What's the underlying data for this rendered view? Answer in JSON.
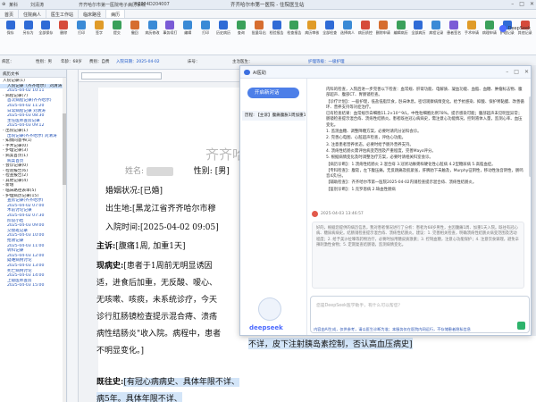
{
  "titlebar": {
    "left_items": [
      "齐齐哈尔市第一医院",
      "科室：",
      "登录人：刘清涛",
      "门诊号：",
      "住院号：",
      "发布 4.0",
      "HIS编码：",
      "住院号:"
    ],
    "left_texts": [
      "某科",
      "刘清涛",
      "齐齐哈尔市第一医院电子病历系统",
      "#2024D204007"
    ],
    "center_title": "齐齐哈尔市第一医院 - 住院医生站"
  },
  "tabs": [
    "首页",
    "住院病人",
    "医生工作站",
    "临床路径",
    "病历"
  ],
  "toolbar": {
    "buttons": [
      "保存",
      "另存为",
      "全部保存",
      "删除",
      "打印",
      "签字",
      "提交",
      "撤回",
      "病历修改",
      "事务续打",
      "编辑",
      "打印",
      "历史病历",
      "查询",
      "批量导出",
      "检验报告",
      "检查报告",
      "病历审核",
      "全部检查",
      "选择病人",
      "病历质控",
      "删除申请",
      "编辑病历",
      "全部病历",
      "病程记录",
      "患者签名",
      "手术申请",
      "病理申请",
      "护理记录",
      "其他记录"
    ],
    "colors": [
      "#2f6bd6",
      "#2f6bd6",
      "#2f6bd6",
      "#d64b3b",
      "#3a8ad6",
      "#e09b28",
      "#3aa05a",
      "#d66d2f",
      "#3a8ad6",
      "#7a5bd6",
      "#3a8ad6",
      "#3a8ad6",
      "#2f6bd6",
      "#3aa05a",
      "#d66d2f",
      "#2f6bd6",
      "#3aa05a",
      "#e09b28",
      "#2f6bd6",
      "#3a8ad6",
      "#d64b3b",
      "#d66d2f",
      "#3aa05a",
      "#2f6bd6",
      "#3a8ad6",
      "#7a5bd6",
      "#e09b28",
      "#3aa05a",
      "#2f6bd6",
      "#d64b3b"
    ],
    "right_label": "DeepSeek"
  },
  "infobar": {
    "items": [
      "病区：",
      "性别：男",
      "年龄：68岁",
      "费别：自费",
      "入院日期：2025-04-02",
      "床号：",
      "主治医生：",
      "护理等级：一级护理"
    ],
    "address_label": "出生地：黑龙江省齐齐哈尔市 ..."
  },
  "left_panel": {
    "header": "病历文书",
    "tree": [
      {
        "label": "入院记录(1)",
        "level": 0,
        "style": "normal"
      },
      {
        "label": "入院记录（齐齐哈尔）  刘清涛",
        "level": 1,
        "style": "sel"
      },
      {
        "label": "2025-04-02 10:11",
        "level": 1,
        "style": "blue"
      },
      {
        "label": "- 病程记录(7)",
        "level": 0,
        "style": "normal"
      },
      {
        "label": "首次病程记录(齐齐哈尔)",
        "level": 1,
        "style": "blue"
      },
      {
        "label": "2025-04-02 11:20",
        "level": 1,
        "style": "blue"
      },
      {
        "label": "日常病程记录 刘清涛",
        "level": 1,
        "style": "blue"
      },
      {
        "label": "2025-04-03 08:30",
        "level": 1,
        "style": "blue"
      },
      {
        "label": "主任医师查房记录",
        "level": 1,
        "style": "blue"
      },
      {
        "label": "2025-04-03 09:12",
        "level": 1,
        "style": "blue"
      },
      {
        "label": "- 出院记录(1)",
        "level": 0,
        "style": "normal"
      },
      {
        "label": "出院记录(齐齐哈尔) 刘清涛",
        "level": 1,
        "style": "blue"
      },
      {
        "label": "- 知情同意书(1)",
        "level": 0,
        "style": "normal"
      },
      {
        "label": "- 手术记录(0)",
        "level": 0,
        "style": "normal"
      },
      {
        "label": "- 护理记录(3)",
        "level": 0,
        "style": "normal"
      },
      {
        "label": "- 病案首页(1)",
        "level": 0,
        "style": "normal"
      },
      {
        "label": "病案首页",
        "level": 1,
        "style": "blue"
      },
      {
        "label": "- 会诊记录(0)",
        "level": 0,
        "style": "normal"
      },
      {
        "label": "- 检验报告(6)",
        "level": 0,
        "style": "normal"
      },
      {
        "label": "- 检查报告(2)",
        "level": 0,
        "style": "normal"
      },
      {
        "label": "- 其他记录(4)",
        "level": 0,
        "style": "normal"
      },
      {
        "label": "- 新增",
        "level": 0,
        "style": "normal"
      },
      {
        "label": "- 临床路径表单(5)",
        "level": 0,
        "style": "normal"
      },
      {
        "label": "- 护理病历记录(15)",
        "level": 0,
        "style": "normal"
      },
      {
        "label": "查房记录(齐齐哈尔)",
        "level": 1,
        "style": "blue"
      },
      {
        "label": "2025-04-02 07:00",
        "level": 1,
        "style": "blue"
      },
      {
        "label": "术前讨论记录",
        "level": 1,
        "style": "blue"
      },
      {
        "label": "2025-04-02 07:30",
        "level": 1,
        "style": "blue"
      },
      {
        "label": "阶段小结",
        "level": 1,
        "style": "blue"
      },
      {
        "label": "2025-04-03 09:00",
        "level": 1,
        "style": "blue"
      },
      {
        "label": "交接班记录",
        "level": 1,
        "style": "blue"
      },
      {
        "label": "2025-04-03 10:00",
        "level": 1,
        "style": "blue"
      },
      {
        "label": "抢救记录",
        "level": 1,
        "style": "blue"
      },
      {
        "label": "2025-04-03 11:00",
        "level": 1,
        "style": "blue"
      },
      {
        "label": "转科记录",
        "level": 1,
        "style": "blue"
      },
      {
        "label": "2025-04-03 12:00",
        "level": 1,
        "style": "blue"
      },
      {
        "label": "疑难病例讨论",
        "level": 1,
        "style": "blue"
      },
      {
        "label": "2025-04-03 13:00",
        "level": 1,
        "style": "blue"
      },
      {
        "label": "死亡病例讨论",
        "level": 1,
        "style": "blue"
      },
      {
        "label": "2025-04-03 14:00",
        "level": 1,
        "style": "blue"
      },
      {
        "label": "上级医师查房",
        "level": 1,
        "style": "blue"
      },
      {
        "label": "2025-04-03 15:00",
        "level": 1,
        "style": "blue"
      }
    ]
  },
  "editor": {
    "toolbar_input": "",
    "watermark": "齐齐哈",
    "name_label": "姓名:",
    "gender_label": "性别:",
    "gender_value": "[男]",
    "marital_label": "婚姻状况:",
    "marital_value": "[已婚]",
    "birthplace_label": "出生地:",
    "birthplace_value": "[黑龙江省齐齐哈尔市穆",
    "admit_label": "入院时间:",
    "admit_value": "[2025-04-02 09:05]",
    "chief_label": "主诉:",
    "chief_value": "[腹痛1周, 加重1天]",
    "hpi_label": "现病史:",
    "hpi_lines": [
      "[患者于1周前无明显诱因",
      "适，进食后加重，无反酸、嗳心、",
      "无咳嗽、咳痰，未系统诊疗，今天",
      "诊行肛肠镜检查提示混合痔、溃疡",
      "病性结肠炎\"收入院。病程中，患者",
      "不明显变化。]"
    ],
    "past_label": "既往史:",
    "past_lines": [
      "[有冠心病病史、具体年限不详、",
      "病5年。具体年限不详、",
      "不详，皮下注射胰岛素控制，否认高血压病史]"
    ]
  },
  "dialog": {
    "title": "AI医助",
    "new_chat": "开启新对话",
    "history_item": "历程: 【主诉】腹痛腹胀1周加重1天",
    "response_paragraphs": [
      "内科的检查，入院后进一步完善以下检查：血常规、肝肾功能、电解质、凝血功能、血脂、血糖、肿瘤标志物、腹部超声、腹部CT、胃肠镜检查。",
      "【诊疗计划】：一般护理，低盐低脂饮食，卧床休息，密切观察病情变化。给予抗感染、抑酸、保护胃黏膜、改善循环、营养支持等对症治疗。",
      "已有检查结果：血常规示白细胞11.2×10^9/L，中性粒细胞比例78%，提示感染可能；腹部超声未见明显异常；肠镜检查提示混合痔、溃疡性结肠炎。患者既往冠心病病史，需注意心功能情况，控制液体入量，监测心率、血压变化。",
      "1. 监测血糖、调整降糖方案，必要时请内分泌科会诊。",
      "2. 完善心电图、心脏超声检查，评估心功能。",
      "3. 注意患者营养状态，必要时给予肠外营养支持。",
      "4. 溃疡性结肠炎需评估病变范围及严重程度，完善Mayo评分。",
      "5. 根据病情变化及时调整治疗方案，必要时请相关科室会诊。",
      "【病历诊断】：1.溃疡性结肠炎 2.混合痔 3.冠状动脉粥样硬化性心脏病 4.2型糖尿病 5.高脂血症。",
      "【专科检查】：腹软，左下腹压痛，无反跳痛及肌紧张，肝脾肋下未触及，Murphy征阴性，移动性浊音阴性，肠鸣音4次/分。",
      "【辅助检查】：齐齐哈尔市第一医院2025-04-02内镜检查提示混合痔、溃疡性结肠炎。",
      "【鉴别诊断】：1.克罗恩病 2.缺血性肠病"
    ],
    "timestamp": "2025-04-03 13:46:57",
    "answer_text": "好的，根据您提供的病历信息，我对患者情况进行了分析：患者为68岁男性，主因腹痛1周、加重1天入院。既往有冠心病、糖尿病病史。结肠镜检查提示混合痔、溃疡性结肠炎。建议：1. 完善相关检查，明确溃疡性结肠炎病变范围及活动程度；2. 给予美沙拉嗪等药物治疗，必要时加用糖皮质激素；3. 控制血糖，注意心功能保护；4. 注意饮食调理，避免辛辣刺激性食物；5. 定期复查结肠镜，监测病情变化。",
    "input_placeholder": "您是DeepSeek医学助手，有什么可以帮您？",
    "brand_name": "deepseek",
    "footer": "内容由AI生成，仅供参考，请以医生诊断为准；本服务仅在医院内网运行，不存储患者隐私信息"
  }
}
